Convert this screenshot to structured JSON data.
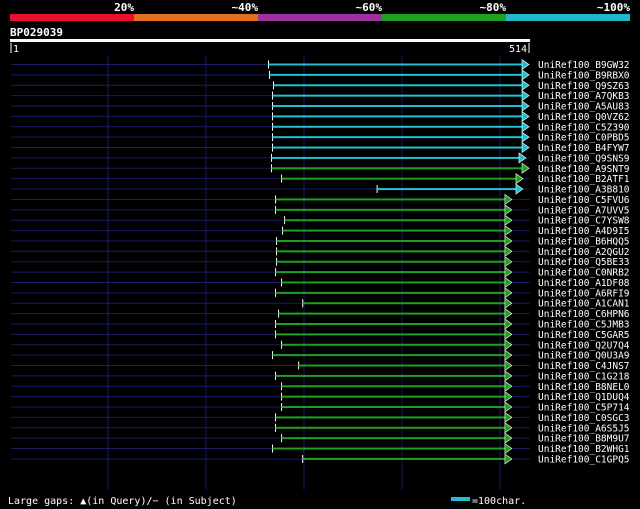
{
  "colors": {
    "background": "#000000",
    "scale": [
      "#e8102c",
      "#e07020",
      "#a030a0",
      "#20a020",
      "#20b8c8"
    ],
    "cyan": "#20c0d0",
    "green": "#20a020",
    "grid": "#1a1a66",
    "ruler": "#ffffff"
  },
  "scale_labels": [
    "20%",
    "~40%",
    "~60%",
    "~80%",
    "~100%"
  ],
  "query": {
    "id": "BP029039",
    "start": "1",
    "end": "514",
    "length": 514
  },
  "footer": {
    "gaps_label": "Large gaps: ▲(in Query)/− (in Subject)",
    "legend_label": "=100char."
  },
  "chart_data": {
    "type": "alignment",
    "query_length": 514,
    "hits": [
      {
        "id": "UniRef100_B9GW32",
        "start": 257,
        "end": 514,
        "identity_band": "~100%"
      },
      {
        "id": "UniRef100_B9RBX0",
        "start": 258,
        "end": 514,
        "identity_band": "~100%"
      },
      {
        "id": "UniRef100_Q9SZ63",
        "start": 262,
        "end": 514,
        "identity_band": "~100%"
      },
      {
        "id": "UniRef100_A7QKB3",
        "start": 261,
        "end": 514,
        "identity_band": "~100%"
      },
      {
        "id": "UniRef100_A5AU83",
        "start": 261,
        "end": 514,
        "identity_band": "~100%"
      },
      {
        "id": "UniRef100_Q0VZ62",
        "start": 261,
        "end": 514,
        "identity_band": "~100%"
      },
      {
        "id": "UniRef100_C5Z390",
        "start": 261,
        "end": 514,
        "identity_band": "~100%"
      },
      {
        "id": "UniRef100_C0PBD5",
        "start": 261,
        "end": 514,
        "identity_band": "~100%"
      },
      {
        "id": "UniRef100_B4FYW7",
        "start": 261,
        "end": 514,
        "identity_band": "~100%"
      },
      {
        "id": "UniRef100_Q9SNS9",
        "start": 260,
        "end": 511,
        "identity_band": "~100%"
      },
      {
        "id": "UniRef100_A9SNT9",
        "start": 260,
        "end": 514,
        "identity_band": "~80%"
      },
      {
        "id": "UniRef100_B2ATF1",
        "start": 270,
        "end": 508,
        "identity_band": "~80%"
      },
      {
        "id": "UniRef100_A3B810",
        "start": 365,
        "end": 508,
        "identity_band": "~100%"
      },
      {
        "id": "UniRef100_C5FVU6",
        "start": 264,
        "end": 497,
        "identity_band": "~80%"
      },
      {
        "id": "UniRef100_A7UVV5",
        "start": 264,
        "end": 497,
        "identity_band": "~80%"
      },
      {
        "id": "UniRef100_C7YSW8",
        "start": 273,
        "end": 497,
        "identity_band": "~80%"
      },
      {
        "id": "UniRef100_A4D9I5",
        "start": 271,
        "end": 497,
        "identity_band": "~80%"
      },
      {
        "id": "UniRef100_B6HQQ5",
        "start": 265,
        "end": 497,
        "identity_band": "~80%"
      },
      {
        "id": "UniRef100_A2QGU2",
        "start": 265,
        "end": 497,
        "identity_band": "~80%"
      },
      {
        "id": "UniRef100_Q5BE33",
        "start": 265,
        "end": 497,
        "identity_band": "~80%"
      },
      {
        "id": "UniRef100_C0NRB2",
        "start": 264,
        "end": 497,
        "identity_band": "~80%"
      },
      {
        "id": "UniRef100_A1DF08",
        "start": 270,
        "end": 497,
        "identity_band": "~80%"
      },
      {
        "id": "UniRef100_A6RFI9",
        "start": 264,
        "end": 497,
        "identity_band": "~80%"
      },
      {
        "id": "UniRef100_A1CAN1",
        "start": 291,
        "end": 497,
        "identity_band": "~80%"
      },
      {
        "id": "UniRef100_C6HPN6",
        "start": 267,
        "end": 497,
        "identity_band": "~80%"
      },
      {
        "id": "UniRef100_C5JMB3",
        "start": 264,
        "end": 497,
        "identity_band": "~80%"
      },
      {
        "id": "UniRef100_C5GAR5",
        "start": 264,
        "end": 497,
        "identity_band": "~80%"
      },
      {
        "id": "UniRef100_Q2U7Q4",
        "start": 270,
        "end": 497,
        "identity_band": "~80%"
      },
      {
        "id": "UniRef100_Q0U3A9",
        "start": 261,
        "end": 497,
        "identity_band": "~80%"
      },
      {
        "id": "UniRef100_C4JNS7",
        "start": 287,
        "end": 497,
        "identity_band": "~80%"
      },
      {
        "id": "UniRef100_C1G218",
        "start": 264,
        "end": 497,
        "identity_band": "~80%"
      },
      {
        "id": "UniRef100_B8NEL0",
        "start": 270,
        "end": 497,
        "identity_band": "~80%"
      },
      {
        "id": "UniRef100_Q1DUQ4",
        "start": 270,
        "end": 497,
        "identity_band": "~80%"
      },
      {
        "id": "UniRef100_C5P714",
        "start": 270,
        "end": 497,
        "identity_band": "~80%"
      },
      {
        "id": "UniRef100_C0SGC3",
        "start": 264,
        "end": 497,
        "identity_band": "~80%"
      },
      {
        "id": "UniRef100_A6S5J5",
        "start": 264,
        "end": 497,
        "identity_band": "~80%"
      },
      {
        "id": "UniRef100_B8M9U7",
        "start": 270,
        "end": 497,
        "identity_band": "~80%"
      },
      {
        "id": "UniRef100_B2WHG1",
        "start": 261,
        "end": 497,
        "identity_band": "~80%"
      },
      {
        "id": "UniRef100_C1GPQ5",
        "start": 291,
        "end": 497,
        "identity_band": "~80%"
      }
    ]
  }
}
